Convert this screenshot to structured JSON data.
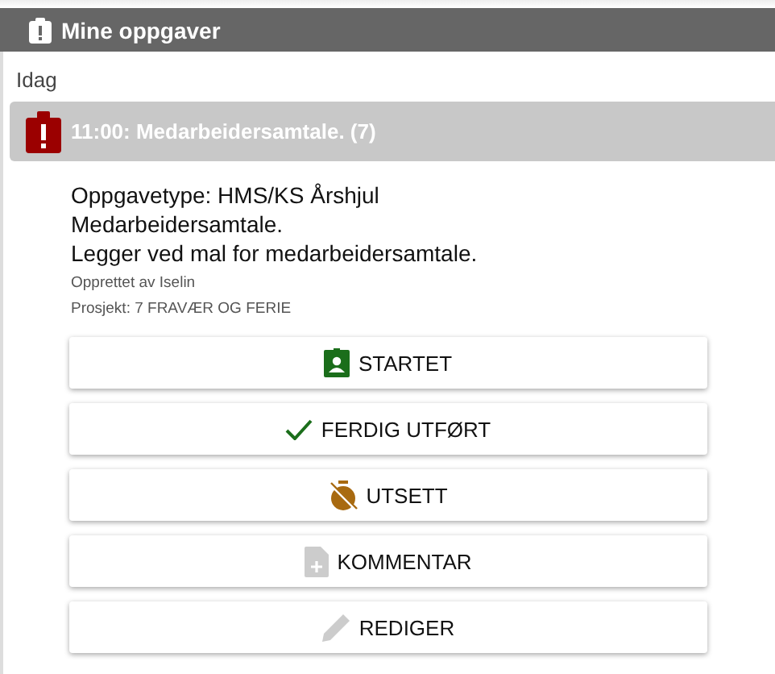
{
  "panel": {
    "title": "Mine oppgaver"
  },
  "group": {
    "label": "Idag"
  },
  "task": {
    "title": "11:00: Medarbeidersamtale. (7)",
    "lines": [
      "Oppgavetype: HMS/KS Årshjul",
      "Medarbeidersamtale.",
      "Legger ved mal for medarbeidersamtale."
    ],
    "meta": [
      "Opprettet av Iselin",
      "Prosjekt: 7 FRAVÆR OG FERIE"
    ]
  },
  "buttons": [
    {
      "kind": "badge",
      "label": "STARTET"
    },
    {
      "kind": "check",
      "label": "FERDIG UTFØRT"
    },
    {
      "kind": "timer-off",
      "label": "UTSETT"
    },
    {
      "kind": "note-add",
      "label": "KOMMENTAR"
    },
    {
      "kind": "pencil",
      "label": "REDIGER"
    }
  ]
}
